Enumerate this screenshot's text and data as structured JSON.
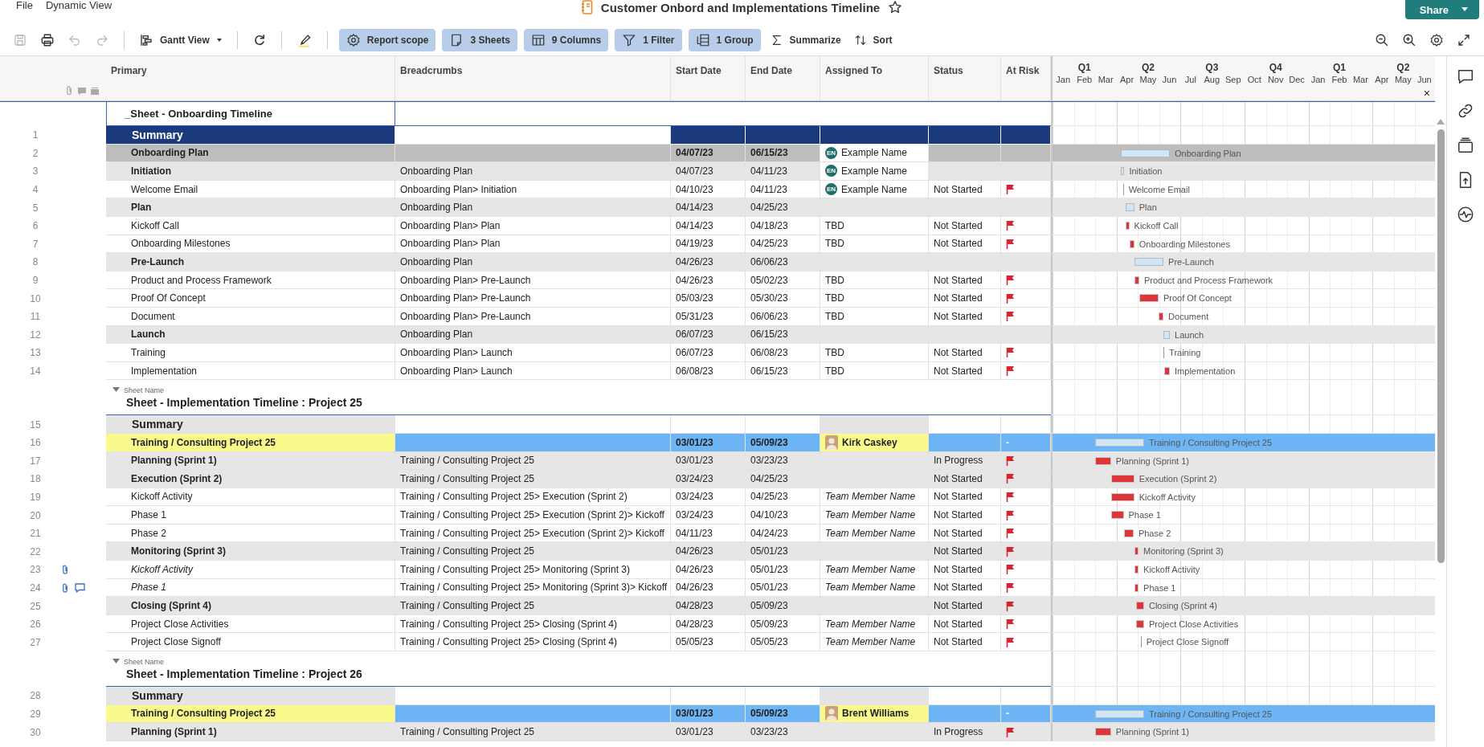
{
  "menu": [
    "File",
    "Dynamic View"
  ],
  "title": "Customer Onbord and Implementations Timeline",
  "share": {
    "label": "Share"
  },
  "toolbar": {
    "tools": [
      {
        "disabled": true
      },
      {
        "disabled": false
      },
      {
        "disabled": true
      },
      {
        "disabled": true
      }
    ],
    "view": "Gantt View",
    "pills": [
      "Report scope",
      "3 Sheets",
      "9 Columns",
      "1 Filter",
      "1 Group"
    ],
    "actions": [
      "Summarize",
      "Sort"
    ]
  },
  "columns": [
    "Primary",
    "Breadcrumbs",
    "Start Date",
    "End Date",
    "Assigned To",
    "Status",
    "At Risk"
  ],
  "gantt": {
    "quarters": [
      "Q1",
      "Q2",
      "Q3",
      "Q4",
      "Q1",
      "Q2"
    ],
    "months": [
      "Jan",
      "Feb",
      "Mar",
      "Apr",
      "May",
      "Jun",
      "Jul",
      "Aug",
      "Sep",
      "Oct",
      "Nov",
      "Dec",
      "Jan",
      "Feb",
      "Mar",
      "Apr",
      "May",
      "Jun"
    ],
    "close": "×"
  },
  "sections": [
    {
      "title": "_Sheet - Onboarding Timeline",
      "rows": [
        {
          "num": "1",
          "kind": "summary-dark",
          "primary": "Summary"
        },
        {
          "num": "2",
          "kind": "group",
          "primary": "Onboarding Plan",
          "start": "04/07/23",
          "end": "06/15/23",
          "assignee": {
            "name": "Example Name",
            "avatar": {
              "kind": "initials",
              "text": "EN"
            }
          },
          "bar": {
            "kind": "summary",
            "label": "Onboarding Plan"
          }
        },
        {
          "num": "3",
          "kind": "parent",
          "primary": "Initiation",
          "breadcrumb": "Onboarding Plan",
          "start": "04/07/23",
          "end": "04/11/23",
          "assignee": {
            "name": "Example Name",
            "avatar": {
              "kind": "initials",
              "text": "EN"
            }
          },
          "bar": {
            "kind": "summary",
            "label": "Initiation"
          }
        },
        {
          "num": "4",
          "kind": "task",
          "primary": "Welcome Email",
          "breadcrumb": "Onboarding Plan> Initiation",
          "start": "04/10/23",
          "end": "04/11/23",
          "assignee": {
            "name": "Example Name",
            "avatar": {
              "kind": "initials",
              "text": "EN"
            }
          },
          "status": "Not Started",
          "at_risk": true,
          "bar": {
            "kind": "line",
            "label": "Welcome Email"
          }
        },
        {
          "num": "5",
          "kind": "parent",
          "primary": "Plan",
          "breadcrumb": "Onboarding Plan",
          "start": "04/14/23",
          "end": "04/25/23",
          "bar": {
            "kind": "summary",
            "label": "Plan"
          }
        },
        {
          "num": "6",
          "kind": "task",
          "primary": "Kickoff Call",
          "breadcrumb": "Onboarding Plan> Plan",
          "start": "04/14/23",
          "end": "04/18/23",
          "assignee": {
            "name": "TBD"
          },
          "status": "Not Started",
          "at_risk": true,
          "bar": {
            "kind": "task",
            "label": "Kickoff Call"
          }
        },
        {
          "num": "7",
          "kind": "task",
          "primary": "Onboarding Milestones",
          "breadcrumb": "Onboarding Plan> Plan",
          "start": "04/19/23",
          "end": "04/25/23",
          "assignee": {
            "name": "TBD"
          },
          "status": "Not Started",
          "at_risk": true,
          "bar": {
            "kind": "task",
            "label": "Onboarding Milestones"
          }
        },
        {
          "num": "8",
          "kind": "parent",
          "primary": "Pre-Launch",
          "breadcrumb": "Onboarding Plan",
          "start": "04/26/23",
          "end": "06/06/23",
          "bar": {
            "kind": "summary",
            "label": "Pre-Launch"
          }
        },
        {
          "num": "9",
          "kind": "task",
          "primary": "Product and Process Framework",
          "breadcrumb": "Onboarding Plan> Pre-Launch",
          "start": "04/26/23",
          "end": "05/02/23",
          "assignee": {
            "name": "TBD"
          },
          "status": "Not Started",
          "at_risk": true,
          "bar": {
            "kind": "task",
            "label": "Product and Process Framework"
          }
        },
        {
          "num": "10",
          "kind": "task",
          "primary": "Proof Of Concept",
          "breadcrumb": "Onboarding Plan> Pre-Launch",
          "start": "05/03/23",
          "end": "05/30/23",
          "assignee": {
            "name": "TBD"
          },
          "status": "Not Started",
          "at_risk": true,
          "bar": {
            "kind": "task",
            "label": "Proof Of Concept"
          }
        },
        {
          "num": "11",
          "kind": "task",
          "primary": "Document",
          "breadcrumb": "Onboarding Plan> Pre-Launch",
          "start": "05/31/23",
          "end": "06/06/23",
          "assignee": {
            "name": "TBD"
          },
          "status": "Not Started",
          "at_risk": true,
          "bar": {
            "kind": "task",
            "label": "Document"
          }
        },
        {
          "num": "12",
          "kind": "parent",
          "primary": "Launch",
          "breadcrumb": "Onboarding Plan",
          "start": "06/07/23",
          "end": "06/15/23",
          "bar": {
            "kind": "summary",
            "label": "Launch"
          }
        },
        {
          "num": "13",
          "kind": "task",
          "primary": "Training",
          "breadcrumb": "Onboarding Plan> Launch",
          "start": "06/07/23",
          "end": "06/08/23",
          "assignee": {
            "name": "TBD"
          },
          "status": "Not Started",
          "at_risk": true,
          "bar": {
            "kind": "line",
            "label": "Training"
          }
        },
        {
          "num": "14",
          "kind": "task",
          "primary": "Implementation",
          "breadcrumb": "Onboarding Plan> Launch",
          "start": "06/08/23",
          "end": "06/15/23",
          "assignee": {
            "name": "TBD"
          },
          "status": "Not Started",
          "at_risk": true,
          "bar": {
            "kind": "task",
            "label": "Implementation"
          }
        }
      ]
    },
    {
      "label": "Sheet Name",
      "title": "Sheet - Implementation Timeline : Project 25",
      "rows": [
        {
          "num": "15",
          "kind": "summary",
          "primary": "Summary"
        },
        {
          "num": "16",
          "kind": "project",
          "primary": "Training / Consulting Project 25",
          "start": "03/01/23",
          "end": "05/09/23",
          "assignee": {
            "name": "Kirk Caskey",
            "avatar": {
              "kind": "photo"
            }
          },
          "at_risk_text": "-",
          "bar": {
            "kind": "summary",
            "label": "Training / Consulting Project 25"
          }
        },
        {
          "num": "17",
          "kind": "parent",
          "primary": "Planning (Sprint 1)",
          "breadcrumb": "Training / Consulting Project 25",
          "start": "03/01/23",
          "end": "03/23/23",
          "status": "In Progress",
          "at_risk": true,
          "bar": {
            "kind": "task",
            "label": "Planning (Sprint 1)"
          }
        },
        {
          "num": "18",
          "kind": "parent",
          "primary": "Execution (Sprint 2)",
          "breadcrumb": "Training / Consulting Project 25",
          "start": "03/24/23",
          "end": "04/25/23",
          "status": "Not Started",
          "at_risk": true,
          "bar": {
            "kind": "task",
            "label": "Execution (Sprint 2)"
          }
        },
        {
          "num": "19",
          "kind": "task",
          "primary": "Kickoff Activity",
          "breadcrumb": "Training / Consulting Project 25> Execution (Sprint 2)",
          "start": "03/24/23",
          "end": "04/25/23",
          "assignee": {
            "name": "Team Member Name",
            "italic": true
          },
          "status": "Not Started",
          "at_risk": true,
          "bar": {
            "kind": "task",
            "label": "Kickoff Activity"
          }
        },
        {
          "num": "20",
          "kind": "task",
          "primary": "Phase 1",
          "breadcrumb": "Training / Consulting Project 25> Execution (Sprint 2)> Kickoff",
          "start": "03/24/23",
          "end": "04/10/23",
          "assignee": {
            "name": "Team Member Name",
            "italic": true
          },
          "status": "Not Started",
          "at_risk": true,
          "bar": {
            "kind": "task",
            "label": "Phase 1"
          }
        },
        {
          "num": "21",
          "kind": "task",
          "primary": "Phase 2",
          "breadcrumb": "Training / Consulting Project 25> Execution (Sprint 2)> Kickoff",
          "start": "04/11/23",
          "end": "04/24/23",
          "assignee": {
            "name": "Team Member Name",
            "italic": true
          },
          "status": "Not Started",
          "at_risk": true,
          "bar": {
            "kind": "task",
            "label": "Phase 2"
          }
        },
        {
          "num": "22",
          "kind": "parent",
          "primary": "Monitoring (Sprint 3)",
          "breadcrumb": "Training / Consulting Project 25",
          "start": "04/26/23",
          "end": "05/01/23",
          "status": "Not Started",
          "at_risk": true,
          "bar": {
            "kind": "task",
            "label": "Monitoring (Sprint 3)"
          }
        },
        {
          "num": "23",
          "kind": "task",
          "italic": true,
          "attachment": true,
          "comment": false,
          "primary": "Kickoff Activity",
          "breadcrumb": "Training / Consulting Project 25> Monitoring (Sprint 3)",
          "start": "04/26/23",
          "end": "05/01/23",
          "assignee": {
            "name": "Team Member Name",
            "italic": true
          },
          "status": "Not Started",
          "at_risk": true,
          "bar": {
            "kind": "task",
            "label": "Kickoff Activity"
          }
        },
        {
          "num": "24",
          "kind": "task",
          "italic": true,
          "attachment": true,
          "comment": true,
          "primary": "Phase 1",
          "breadcrumb": "Training / Consulting Project 25> Monitoring (Sprint 3)> Kickoff",
          "start": "04/26/23",
          "end": "05/01/23",
          "assignee": {
            "name": "Team Member Name",
            "italic": true
          },
          "status": "Not Started",
          "at_risk": true,
          "bar": {
            "kind": "task",
            "label": "Phase 1"
          }
        },
        {
          "num": "25",
          "kind": "parent",
          "primary": "Closing (Sprint 4)",
          "breadcrumb": "Training / Consulting Project 25",
          "start": "04/28/23",
          "end": "05/09/23",
          "status": "Not Started",
          "at_risk": true,
          "bar": {
            "kind": "task",
            "label": "Closing (Sprint 4)"
          }
        },
        {
          "num": "26",
          "kind": "task",
          "primary": "Project Close Activities",
          "breadcrumb": "Training / Consulting Project 25> Closing (Sprint 4)",
          "start": "04/28/23",
          "end": "05/09/23",
          "assignee": {
            "name": "Team Member Name",
            "italic": true
          },
          "status": "Not Started",
          "at_risk": true,
          "bar": {
            "kind": "task",
            "label": "Project Close Activities"
          }
        },
        {
          "num": "27",
          "kind": "task",
          "primary": "Project Close Signoff",
          "breadcrumb": "Training / Consulting Project 25> Closing (Sprint 4)",
          "start": "05/05/23",
          "end": "05/05/23",
          "assignee": {
            "name": "Team Member Name",
            "italic": true
          },
          "status": "Not Started",
          "at_risk": true,
          "bar": {
            "kind": "line",
            "label": "Project Close Signoff"
          }
        }
      ]
    },
    {
      "label": "Sheet Name",
      "title": "Sheet - Implementation Timeline : Project 26",
      "rows": [
        {
          "num": "28",
          "kind": "summary",
          "primary": "Summary"
        },
        {
          "num": "29",
          "kind": "project",
          "primary": "Training / Consulting Project 25",
          "start": "03/01/23",
          "end": "05/09/23",
          "assignee": {
            "name": "Brent Williams",
            "avatar": {
              "kind": "photo"
            }
          },
          "at_risk_text": "-",
          "bar": {
            "kind": "summary",
            "label": "Training / Consulting Project 25"
          }
        },
        {
          "num": "30",
          "kind": "parent",
          "primary": "Planning (Sprint 1)",
          "breadcrumb": "Training / Consulting Project 25",
          "start": "03/01/23",
          "end": "03/23/23",
          "status": "In Progress",
          "at_risk": true,
          "bar": {
            "kind": "task",
            "label": "Planning (Sprint 1)"
          }
        }
      ]
    }
  ]
}
